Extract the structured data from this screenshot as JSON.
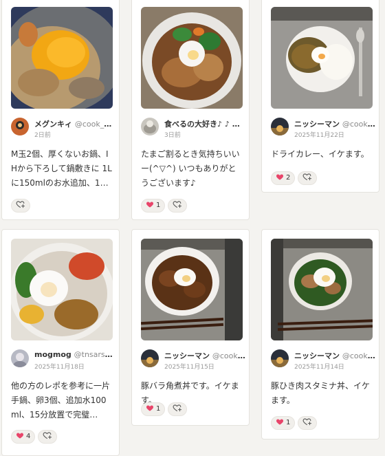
{
  "colors": {
    "heart": "#e8456a",
    "background": "#f4f3f0",
    "card": "#ffffff"
  },
  "cards": [
    {
      "username": "メグンキィ",
      "handle": "@cook_406...",
      "date": "2日前",
      "comment": "M玉2個、厚くないお鍋、IHから下ろして鍋敷きに 1Lに150mlのお水追加、13分…",
      "likes": "",
      "liked": false
    },
    {
      "username": "食べるの大好き♪ ♪ …",
      "handle": "",
      "date": "3日前",
      "comment": "たまご割るとき気持ちいいー(^▽^) いつもありがとうございます♪",
      "likes": "1",
      "liked": true
    },
    {
      "username": "ニッシーマン",
      "handle": "@cook_4...",
      "date": "2025年11月22日",
      "comment": "ドライカレー、イケます。",
      "likes": "2",
      "liked": true
    },
    {
      "username": "mogmog",
      "handle": "@tnsarsmm",
      "date": "2025年11月18日",
      "comment": "他の方のレポを参考に一片手鍋、卵3個、追加水100ml、15分放置で完璧…",
      "likes": "4",
      "liked": true
    },
    {
      "username": "ニッシーマン",
      "handle": "@cook_4...",
      "date": "2025年11月15日",
      "comment": "豚バラ角煮丼です。イケます。",
      "likes": "1",
      "liked": true
    },
    {
      "username": "ニッシーマン",
      "handle": "@cook_4...",
      "date": "2025年11月14日",
      "comment": "豚ひき肉スタミナ丼、イケます。",
      "likes": "1",
      "liked": true
    }
  ]
}
